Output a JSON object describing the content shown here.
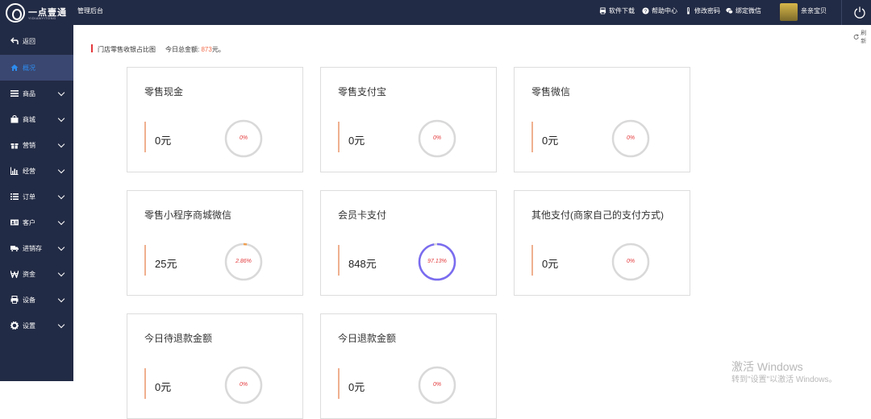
{
  "header": {
    "brand": "一点壹通",
    "brand_sub": "YIDIANYITONG",
    "admin_title": "管理后台",
    "actions": [
      {
        "label": "软件下载",
        "icon": "printer-icon"
      },
      {
        "label": "帮助中心",
        "icon": "help-icon"
      },
      {
        "label": "修改密码",
        "icon": "thermometer-icon"
      },
      {
        "label": "绑定微信",
        "icon": "wechat-icon"
      }
    ],
    "username": "亲亲宝贝"
  },
  "sidebar": {
    "items": [
      {
        "label": "返回",
        "icon": "back-arrow-icon",
        "has_chevron": false
      },
      {
        "label": "概况",
        "icon": "home-icon",
        "has_chevron": false,
        "active": true
      },
      {
        "label": "商品",
        "icon": "list-icon",
        "has_chevron": true
      },
      {
        "label": "商城",
        "icon": "bag-icon",
        "has_chevron": true
      },
      {
        "label": "营销",
        "icon": "gift-icon",
        "has_chevron": true
      },
      {
        "label": "经营",
        "icon": "bar-chart-icon",
        "has_chevron": true
      },
      {
        "label": "订单",
        "icon": "order-list-icon",
        "has_chevron": true
      },
      {
        "label": "客户",
        "icon": "id-card-icon",
        "has_chevron": true
      },
      {
        "label": "进销存",
        "icon": "truck-icon",
        "has_chevron": true
      },
      {
        "label": "资金",
        "icon": "currency-icon",
        "has_chevron": true
      },
      {
        "label": "设备",
        "icon": "printer-icon",
        "has_chevron": true
      },
      {
        "label": "设置",
        "icon": "gear-icon",
        "has_chevron": true
      }
    ]
  },
  "main": {
    "refresh_label": "刷新",
    "section_title": "门店零售收银占比图",
    "total_label": "今日总金额: ",
    "total_value": "873",
    "total_suffix": "元。",
    "cards": [
      {
        "title": "零售现金",
        "amount": "0元",
        "percent_label": "0%",
        "percent": 0,
        "color": "#e4393c"
      },
      {
        "title": "零售支付宝",
        "amount": "0元",
        "percent_label": "0%",
        "percent": 0,
        "color": "#e4393c"
      },
      {
        "title": "零售微信",
        "amount": "0元",
        "percent_label": "0%",
        "percent": 0,
        "color": "#e4393c"
      },
      {
        "title": "零售小程序商城微信",
        "amount": "25元",
        "percent_label": "2.86%",
        "percent": 2.86,
        "color": "#f0a050"
      },
      {
        "title": "会员卡支付",
        "amount": "848元",
        "percent_label": "97.13%",
        "percent": 97.13,
        "color": "#7a6cf0"
      },
      {
        "title": "其他支付(商家自己的支付方式)",
        "amount": "0元",
        "percent_label": "0%",
        "percent": 0,
        "color": "#e4393c"
      },
      {
        "title": "今日待退款金额",
        "amount": "0元",
        "percent_label": "0%",
        "percent": 0,
        "color": "#f0a050"
      },
      {
        "title": "今日退款金额",
        "amount": "0元",
        "percent_label": "0%",
        "percent": 0,
        "color": "#5ac8f0"
      }
    ]
  },
  "watermark": {
    "line1": "激活 Windows",
    "line2": "转到\"设置\"以激活 Windows。"
  }
}
